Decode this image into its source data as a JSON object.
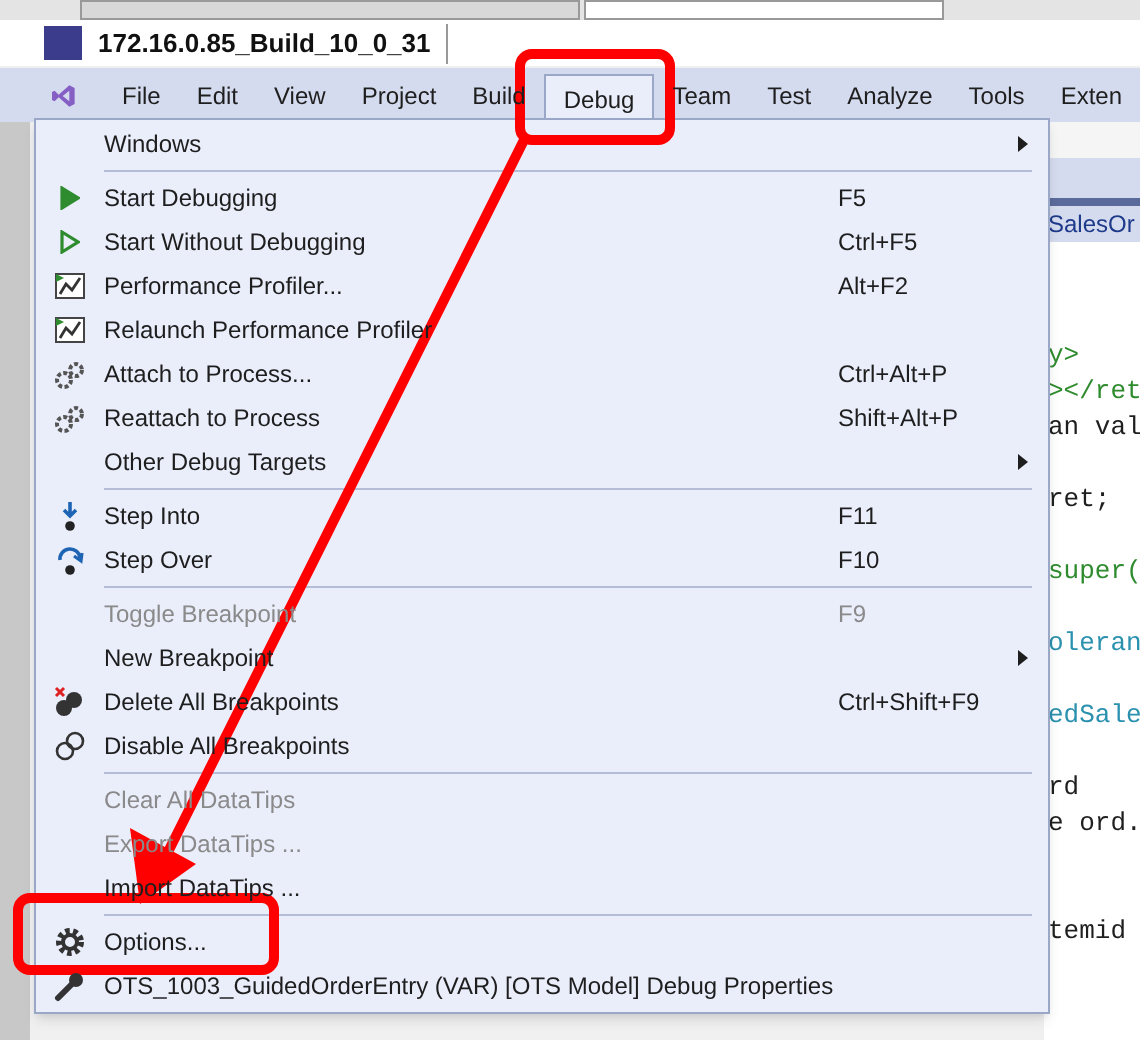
{
  "remote_tab": {
    "title": "172.16.0.85_Build_10_0_31"
  },
  "menu_bar": [
    {
      "label": "File",
      "selected": false
    },
    {
      "label": "Edit",
      "selected": false
    },
    {
      "label": "View",
      "selected": false
    },
    {
      "label": "Project",
      "selected": false
    },
    {
      "label": "Build",
      "selected": false
    },
    {
      "label": "Debug",
      "selected": true
    },
    {
      "label": "Team",
      "selected": false
    },
    {
      "label": "Test",
      "selected": false
    },
    {
      "label": "Analyze",
      "selected": false
    },
    {
      "label": "Tools",
      "selected": false
    },
    {
      "label": "Exten",
      "selected": false
    }
  ],
  "debug_menu": [
    {
      "kind": "item",
      "label": "Windows",
      "disabled": false,
      "submenu": true
    },
    {
      "kind": "separator"
    },
    {
      "kind": "item",
      "label": "Start Debugging",
      "shortcut": "F5",
      "disabled": false,
      "submenu": false
    },
    {
      "kind": "item",
      "label": "Start Without Debugging",
      "shortcut": "Ctrl+F5",
      "disabled": false,
      "submenu": false
    },
    {
      "kind": "item",
      "label": "Performance Profiler...",
      "shortcut": "Alt+F2",
      "disabled": false,
      "submenu": false
    },
    {
      "kind": "item",
      "label": "Relaunch Performance Profiler",
      "disabled": false,
      "submenu": false
    },
    {
      "kind": "item",
      "label": "Attach to Process...",
      "shortcut": "Ctrl+Alt+P",
      "disabled": false,
      "submenu": false
    },
    {
      "kind": "item",
      "label": "Reattach to Process",
      "shortcut": "Shift+Alt+P",
      "disabled": false,
      "submenu": false
    },
    {
      "kind": "item",
      "label": "Other Debug Targets",
      "disabled": false,
      "submenu": true
    },
    {
      "kind": "separator"
    },
    {
      "kind": "item",
      "label": "Step Into",
      "shortcut": "F11",
      "disabled": false,
      "submenu": false
    },
    {
      "kind": "item",
      "label": "Step Over",
      "shortcut": "F10",
      "disabled": false,
      "submenu": false
    },
    {
      "kind": "separator"
    },
    {
      "kind": "item",
      "label": "Toggle Breakpoint",
      "shortcut": "F9",
      "disabled": true,
      "submenu": false
    },
    {
      "kind": "item",
      "label": "New Breakpoint",
      "disabled": false,
      "submenu": true
    },
    {
      "kind": "item",
      "label": "Delete All Breakpoints",
      "shortcut": "Ctrl+Shift+F9",
      "disabled": false,
      "submenu": false
    },
    {
      "kind": "item",
      "label": "Disable All Breakpoints",
      "disabled": false,
      "submenu": false
    },
    {
      "kind": "separator"
    },
    {
      "kind": "item",
      "label": "Clear All DataTips",
      "disabled": true,
      "submenu": false
    },
    {
      "kind": "item",
      "label": "Export DataTips ...",
      "disabled": true,
      "submenu": false
    },
    {
      "kind": "item",
      "label": "Import DataTips ...",
      "disabled": false,
      "submenu": false
    },
    {
      "kind": "separator"
    },
    {
      "kind": "item",
      "label": "Options...",
      "disabled": false,
      "submenu": false
    },
    {
      "kind": "item",
      "label": "OTS_1003_GuidedOrderEntry (VAR) [OTS Model] Debug Properties",
      "disabled": false,
      "submenu": false
    }
  ],
  "editor": {
    "tab": "SalesOr",
    "lines": [
      {
        "kind": "blank"
      },
      {
        "kind": "code",
        "text": "y>",
        "color": "#2e8b2e"
      },
      {
        "kind": "code",
        "text": "></ret",
        "color": "#2e8b2e"
      },
      {
        "kind": "code",
        "text": "an val",
        "color": "#1f1f1f"
      },
      {
        "kind": "blank"
      },
      {
        "kind": "code",
        "text": "ret;",
        "color": "#1f1f1f"
      },
      {
        "kind": "blank"
      },
      {
        "kind": "code",
        "text": "super(",
        "color": "#2e8b2e"
      },
      {
        "kind": "blank"
      },
      {
        "kind": "code",
        "text": "oleran",
        "color": "#2b91af"
      },
      {
        "kind": "blank"
      },
      {
        "kind": "code",
        "text": "edSale",
        "color": "#2b91af"
      },
      {
        "kind": "blank"
      },
      {
        "kind": "code",
        "text": "rd",
        "color": "#1f1f1f"
      },
      {
        "kind": "code",
        "text": "e ord.",
        "color": "#1f1f1f"
      },
      {
        "kind": "blank"
      },
      {
        "kind": "blank"
      },
      {
        "kind": "code",
        "text": "temid",
        "color": "#1f1f1f"
      }
    ]
  }
}
